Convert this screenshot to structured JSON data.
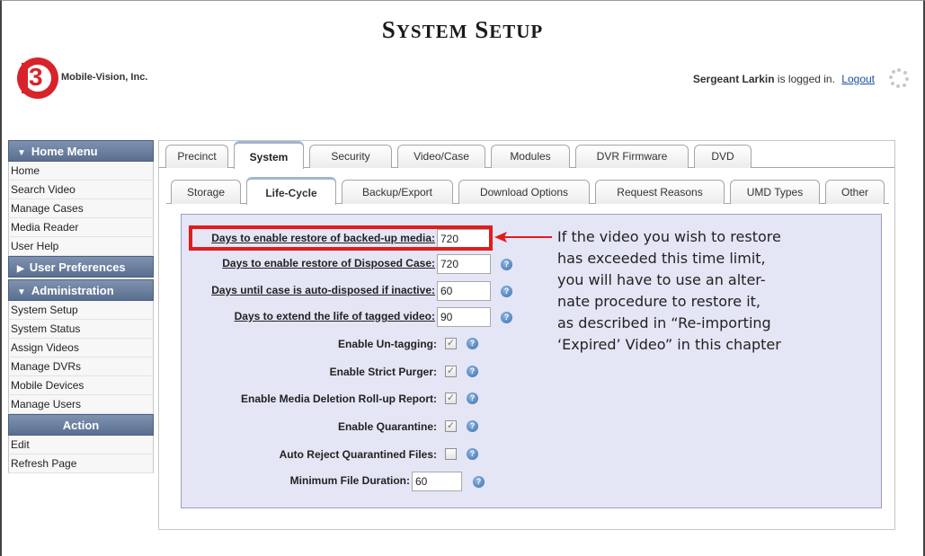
{
  "header": {
    "title_first": "S",
    "title_rest1": "YSTEM",
    "title_space": " ",
    "title_second": "S",
    "title_rest2": "ETUP",
    "company": "Mobile-Vision, Inc.",
    "user_name": "Sergeant Larkin",
    "user_suffix": " is logged in.",
    "logout": "Logout"
  },
  "sidebar": {
    "home_menu": "Home Menu",
    "home_items": [
      "Home",
      "Search Video",
      "Manage Cases",
      "Media Reader",
      "User Help"
    ],
    "user_preferences": "User Preferences",
    "administration": "Administration",
    "admin_items": [
      "System Setup",
      "System Status",
      "Assign Videos",
      "Manage DVRs",
      "Mobile Devices",
      "Manage Users"
    ],
    "action": "Action",
    "action_items": [
      "Edit",
      "Refresh Page"
    ]
  },
  "tabs": [
    "Precinct",
    "System",
    "Security",
    "Video/Case",
    "Modules",
    "DVR Firmware",
    "DVD"
  ],
  "active_tab": "System",
  "subtabs": [
    "Storage",
    "Life-Cycle",
    "Backup/Export",
    "Download Options",
    "Request Reasons",
    "UMD Types",
    "Other"
  ],
  "active_subtab": "Life-Cycle",
  "settings": {
    "restore_backed_up_label": "Days to enable restore of backed-up media:",
    "restore_backed_up_value": "720",
    "restore_disposed_label": "Days to enable restore of Disposed Case:",
    "restore_disposed_value": "720",
    "auto_dispose_label": "Days until case is auto-disposed if inactive:",
    "auto_dispose_value": "60",
    "extend_tagged_label": "Days to extend the life of tagged video:",
    "extend_tagged_value": "90",
    "untagging_label": "Enable Un-tagging:",
    "strict_purger_label": "Enable Strict Purger:",
    "deletion_rollup_label": "Enable Media Deletion Roll-up Report:",
    "quarantine_label": "Enable Quarantine:",
    "auto_reject_label": "Auto Reject Quarantined Files:",
    "min_duration_label": "Minimum File Duration:",
    "min_duration_value": "60",
    "untagging_checked": true,
    "strict_purger_checked": true,
    "deletion_rollup_checked": true,
    "quarantine_checked": true,
    "auto_reject_checked": false
  },
  "annotation": {
    "lines": [
      "If the video you wish to restore",
      "has exceeded this time limit,",
      "you will have to use an alter-",
      "nate procedure to restore it,",
      "as described in “Re-importing",
      "‘Expired’ Video” in this chapter"
    ]
  },
  "colors": {
    "highlight": "#e21c1c",
    "menu_header": "#5a6f90",
    "content_bg": "#e4e5f5"
  }
}
